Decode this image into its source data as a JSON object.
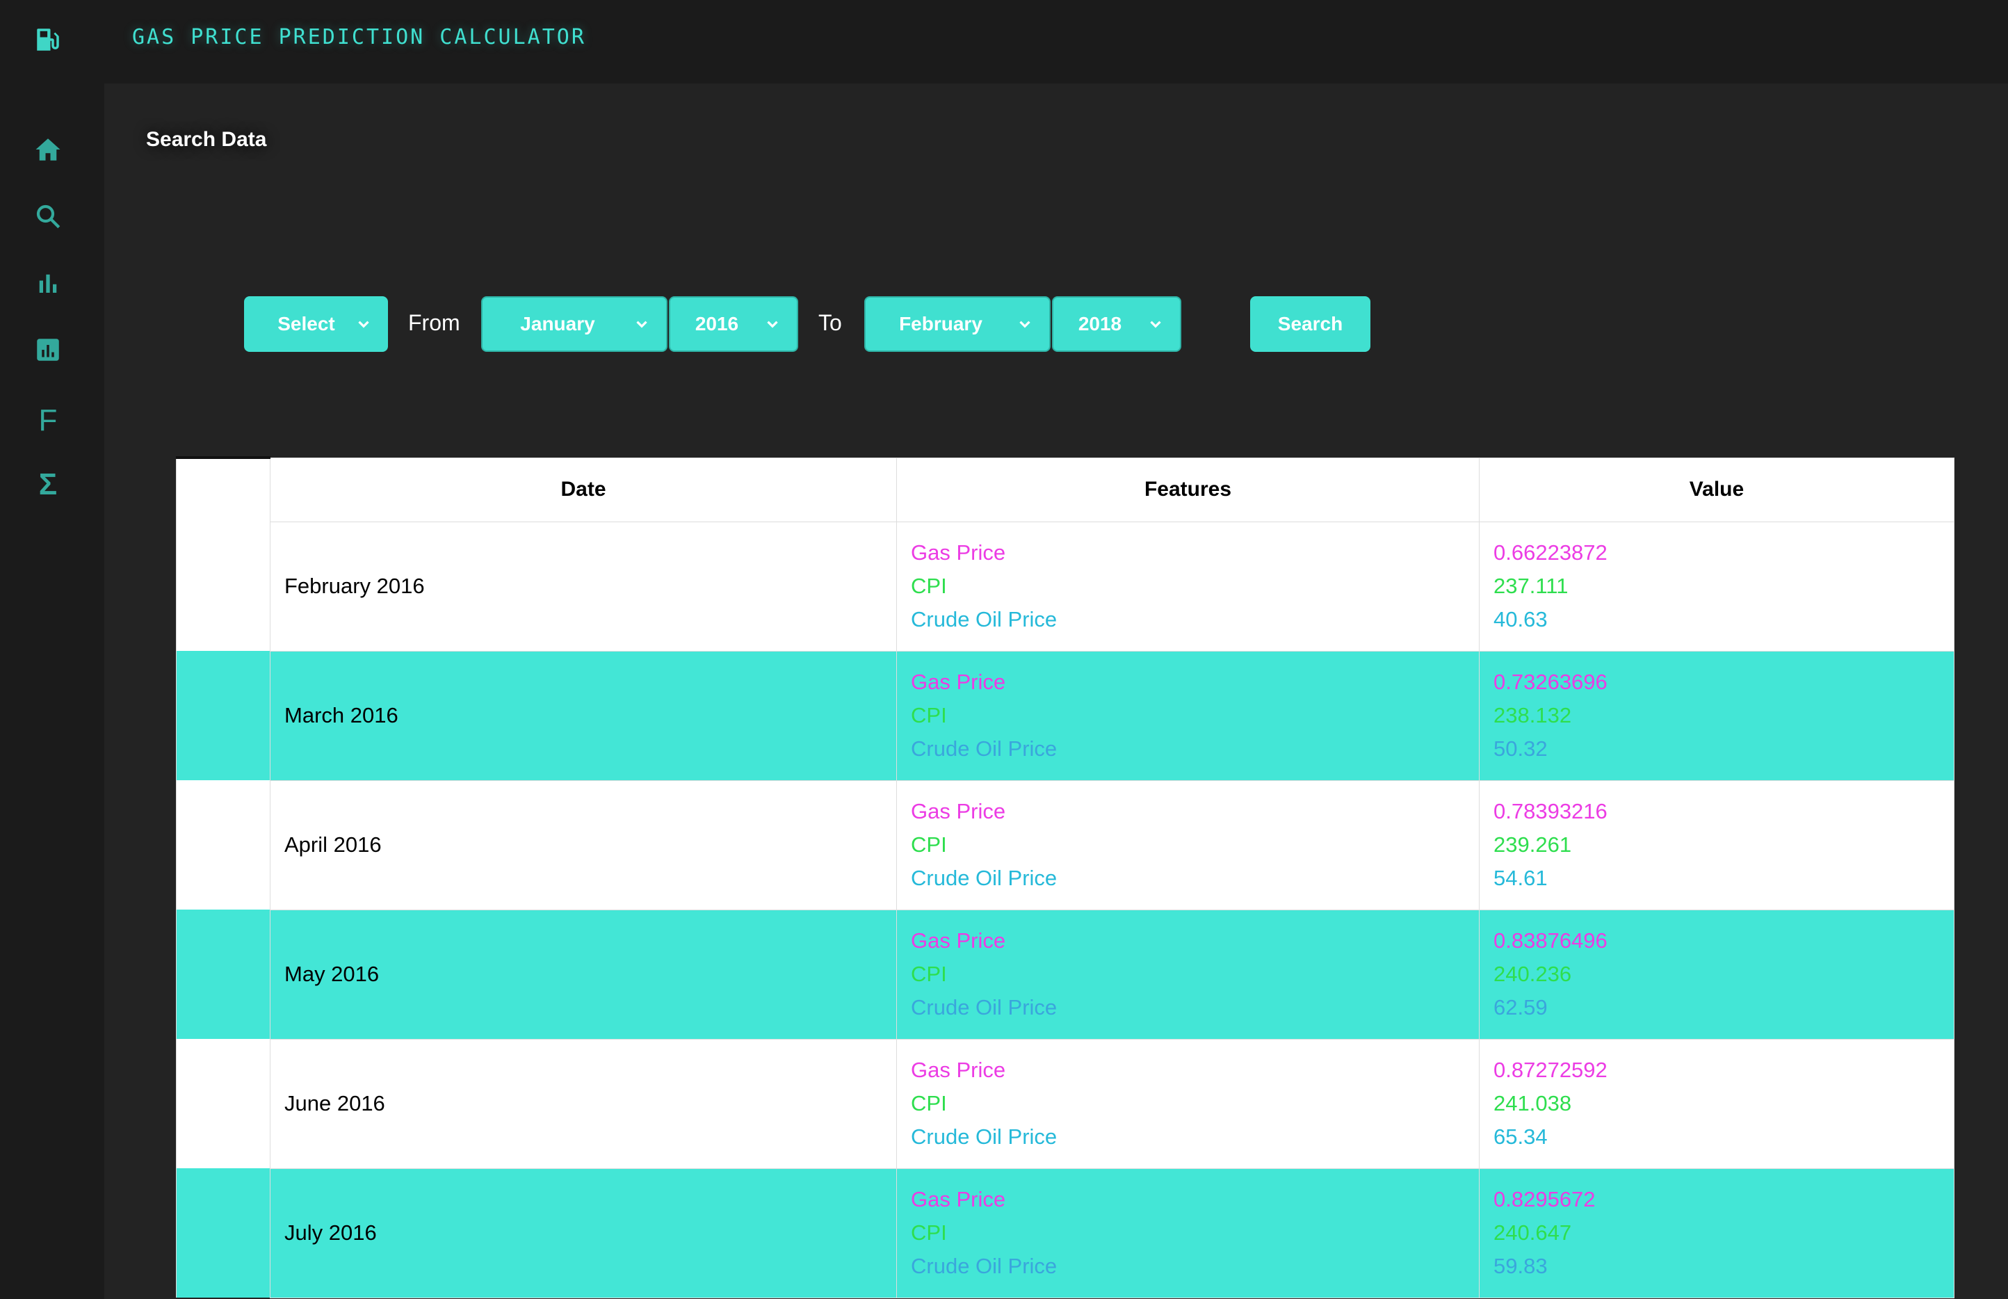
{
  "header": {
    "app_title": "GAS PRICE PREDICTION CALCULATOR",
    "logo_icon": "fuel-pump-icon"
  },
  "sidebar": {
    "items": [
      {
        "icon": "home-icon"
      },
      {
        "icon": "search-icon"
      },
      {
        "icon": "bar-chart-icon"
      },
      {
        "icon": "report-icon"
      },
      {
        "icon": "f-icon",
        "glyph": "F"
      },
      {
        "icon": "sigma-icon",
        "glyph": "Σ"
      }
    ]
  },
  "main": {
    "section_title": "Search Data"
  },
  "filters": {
    "feature_select": "Select",
    "from_label": "From",
    "from_month": "January",
    "from_year": "2016",
    "to_label": "To",
    "to_month": "February",
    "to_year": "2018",
    "search_label": "Search"
  },
  "table": {
    "headers": {
      "date": "Date",
      "features": "Features",
      "value": "Value"
    },
    "rows": [
      {
        "date": "February 2016",
        "features": [
          "Gas Price",
          "CPI",
          "Crude Oil Price"
        ],
        "values": [
          "0.66223872",
          "237.111",
          "40.63"
        ]
      },
      {
        "date": "March 2016",
        "features": [
          "Gas Price",
          "CPI",
          "Crude Oil Price"
        ],
        "values": [
          "0.73263696",
          "238.132",
          "50.32"
        ]
      },
      {
        "date": "April 2016",
        "features": [
          "Gas Price",
          "CPI",
          "Crude Oil Price"
        ],
        "values": [
          "0.78393216",
          "239.261",
          "54.61"
        ]
      },
      {
        "date": "May 2016",
        "features": [
          "Gas Price",
          "CPI",
          "Crude Oil Price"
        ],
        "values": [
          "0.83876496",
          "240.236",
          "62.59"
        ]
      },
      {
        "date": "June 2016",
        "features": [
          "Gas Price",
          "CPI",
          "Crude Oil Price"
        ],
        "values": [
          "0.87272592",
          "241.038",
          "65.34"
        ]
      },
      {
        "date": "July 2016",
        "features": [
          "Gas Price",
          "CPI",
          "Crude Oil Price"
        ],
        "values": [
          "0.8295672",
          "240.647",
          "59.83"
        ]
      }
    ]
  },
  "colors": {
    "accent": "#40e0d0",
    "gas_price": "#ec3ce4",
    "cpi": "#2ede4e",
    "crude_oil": "#25b9d9",
    "background": "#232323"
  }
}
